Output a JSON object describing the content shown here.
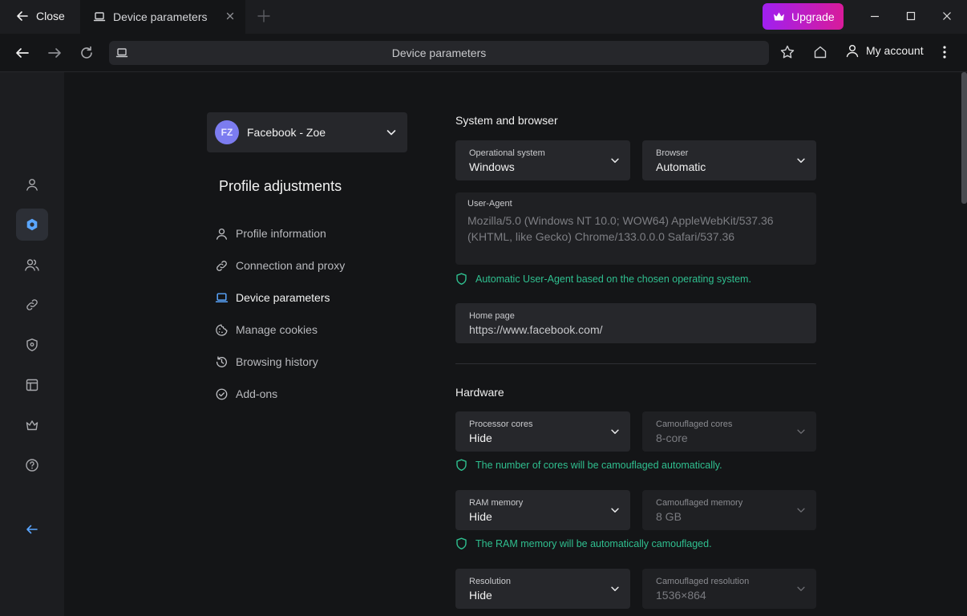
{
  "titlebar": {
    "close_label": "Close",
    "tab_title": "Device parameters",
    "upgrade_label": "Upgrade"
  },
  "navbar": {
    "address_text": "Device parameters",
    "account_label": "My account"
  },
  "profile": {
    "initials": "FZ",
    "name": "Facebook - Zoe"
  },
  "settings_nav": {
    "heading": "Profile adjustments",
    "items": [
      {
        "label": "Profile information",
        "icon": "user-icon"
      },
      {
        "label": "Connection and proxy",
        "icon": "link-icon"
      },
      {
        "label": "Device parameters",
        "icon": "laptop-icon",
        "active": true
      },
      {
        "label": "Manage cookies",
        "icon": "cookie-icon"
      },
      {
        "label": "Browsing history",
        "icon": "history-icon"
      },
      {
        "label": "Add-ons",
        "icon": "check-circle-icon"
      }
    ]
  },
  "system_browser": {
    "title": "System and browser",
    "os_label": "Operational system",
    "os_value": "Windows",
    "browser_label": "Browser",
    "browser_value": "Automatic",
    "ua_label": "User-Agent",
    "ua_value": "Mozilla/5.0 (Windows NT 10.0; WOW64) AppleWebKit/537.36 (KHTML, like Gecko) Chrome/133.0.0.0 Safari/537.36",
    "ua_hint": "Automatic User-Agent based on the chosen operating system.",
    "homepage_label": "Home page",
    "homepage_value": "https://www.facebook.com/"
  },
  "hardware": {
    "title": "Hardware",
    "cores_label": "Processor cores",
    "cores_value": "Hide",
    "camo_cores_label": "Camouflaged cores",
    "camo_cores_value": "8-core",
    "cores_hint": "The number of cores will be camouflaged automatically.",
    "ram_label": "RAM memory",
    "ram_value": "Hide",
    "camo_ram_label": "Camouflaged memory",
    "camo_ram_value": "8 GB",
    "ram_hint": "The RAM memory will be automatically camouflaged.",
    "res_label": "Resolution",
    "res_value": "Hide",
    "camo_res_label": "Camouflaged resolution",
    "camo_res_value": "1536×864"
  },
  "colors": {
    "accent_green": "#2fbf8f",
    "upgrade_start": "#a020f0",
    "upgrade_end": "#d81b9a",
    "avatar": "#7c7cf0"
  }
}
